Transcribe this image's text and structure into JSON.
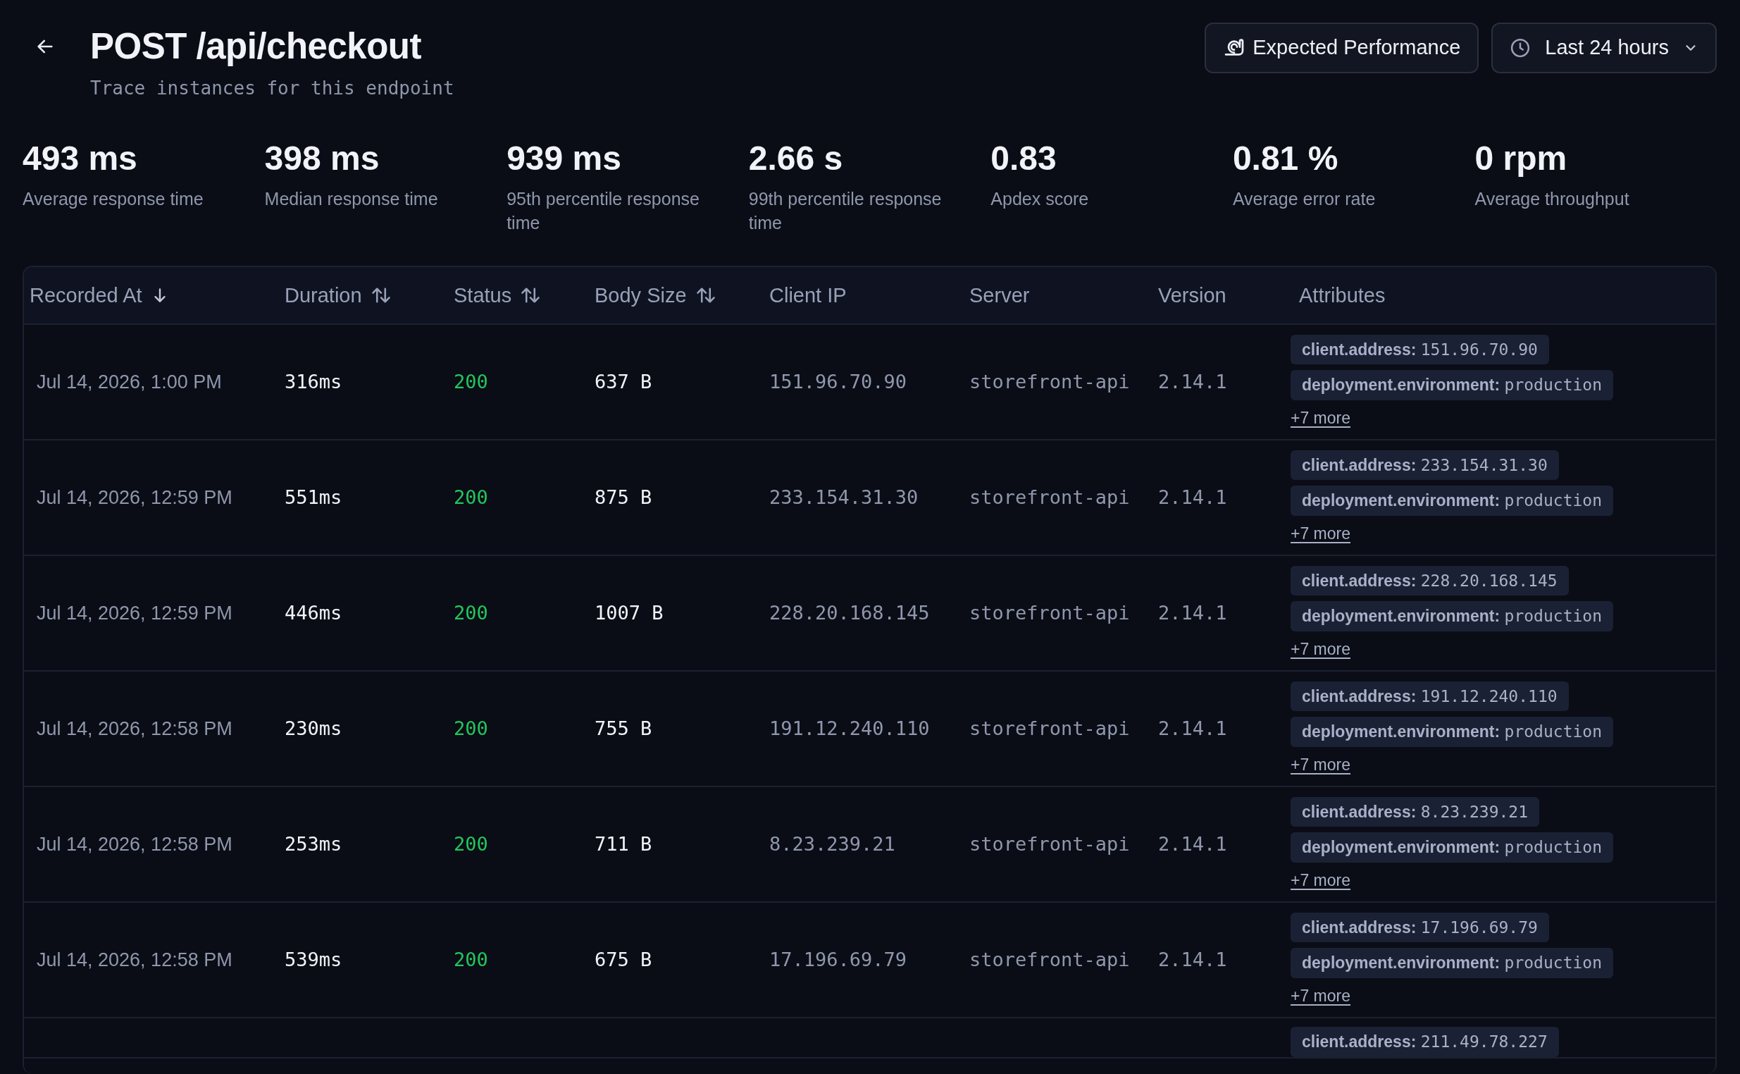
{
  "header": {
    "title": "POST /api/checkout",
    "subtitle": "Trace instances for this endpoint"
  },
  "actions": {
    "performance_button": "Expected Performance",
    "range_select": "Last 24 hours"
  },
  "stats": [
    {
      "value": "493 ms",
      "label": "Average response time"
    },
    {
      "value": "398 ms",
      "label": "Median response time"
    },
    {
      "value": "939 ms",
      "label": "95th percentile response time"
    },
    {
      "value": "2.66 s",
      "label": "99th percentile response time"
    },
    {
      "value": "0.83",
      "label": "Apdex score"
    },
    {
      "value": "0.81 %",
      "label": "Average error rate"
    },
    {
      "value": "0 rpm",
      "label": "Average throughput"
    }
  ],
  "table": {
    "columns": [
      {
        "label": "Recorded At",
        "sortable": true,
        "sorted": true
      },
      {
        "label": "Duration",
        "sortable": true,
        "sorted": false
      },
      {
        "label": "Status",
        "sortable": true,
        "sorted": false
      },
      {
        "label": "Body Size",
        "sortable": true,
        "sorted": false
      },
      {
        "label": "Client IP"
      },
      {
        "label": "Server"
      },
      {
        "label": "Version"
      },
      {
        "label": "Attributes"
      }
    ],
    "rows": [
      {
        "recorded_at": "Jul 14, 2026, 1:00 PM",
        "duration": "316ms",
        "status": "200",
        "body_size": "637 B",
        "client_ip": "151.96.70.90",
        "server": "storefront-api",
        "version": "2.14.1",
        "attributes": [
          {
            "key": "client.address:",
            "value": "151.96.70.90"
          },
          {
            "key": "deployment.environment:",
            "value": "production"
          }
        ],
        "more": "+7 more"
      },
      {
        "recorded_at": "Jul 14, 2026, 12:59 PM",
        "duration": "551ms",
        "status": "200",
        "body_size": "875 B",
        "client_ip": "233.154.31.30",
        "server": "storefront-api",
        "version": "2.14.1",
        "attributes": [
          {
            "key": "client.address:",
            "value": "233.154.31.30"
          },
          {
            "key": "deployment.environment:",
            "value": "production"
          }
        ],
        "more": "+7 more"
      },
      {
        "recorded_at": "Jul 14, 2026, 12:59 PM",
        "duration": "446ms",
        "status": "200",
        "body_size": "1007 B",
        "client_ip": "228.20.168.145",
        "server": "storefront-api",
        "version": "2.14.1",
        "attributes": [
          {
            "key": "client.address:",
            "value": "228.20.168.145"
          },
          {
            "key": "deployment.environment:",
            "value": "production"
          }
        ],
        "more": "+7 more"
      },
      {
        "recorded_at": "Jul 14, 2026, 12:58 PM",
        "duration": "230ms",
        "status": "200",
        "body_size": "755 B",
        "client_ip": "191.12.240.110",
        "server": "storefront-api",
        "version": "2.14.1",
        "attributes": [
          {
            "key": "client.address:",
            "value": "191.12.240.110"
          },
          {
            "key": "deployment.environment:",
            "value": "production"
          }
        ],
        "more": "+7 more"
      },
      {
        "recorded_at": "Jul 14, 2026, 12:58 PM",
        "duration": "253ms",
        "status": "200",
        "body_size": "711 B",
        "client_ip": "8.23.239.21",
        "server": "storefront-api",
        "version": "2.14.1",
        "attributes": [
          {
            "key": "client.address:",
            "value": "8.23.239.21"
          },
          {
            "key": "deployment.environment:",
            "value": "production"
          }
        ],
        "more": "+7 more"
      },
      {
        "recorded_at": "Jul 14, 2026, 12:58 PM",
        "duration": "539ms",
        "status": "200",
        "body_size": "675 B",
        "client_ip": "17.196.69.79",
        "server": "storefront-api",
        "version": "2.14.1",
        "attributes": [
          {
            "key": "client.address:",
            "value": "17.196.69.79"
          },
          {
            "key": "deployment.environment:",
            "value": "production"
          }
        ],
        "more": "+7 more"
      },
      {
        "attributes": [
          {
            "key": "client.address:",
            "value": "211.49.78.227"
          }
        ]
      }
    ]
  }
}
